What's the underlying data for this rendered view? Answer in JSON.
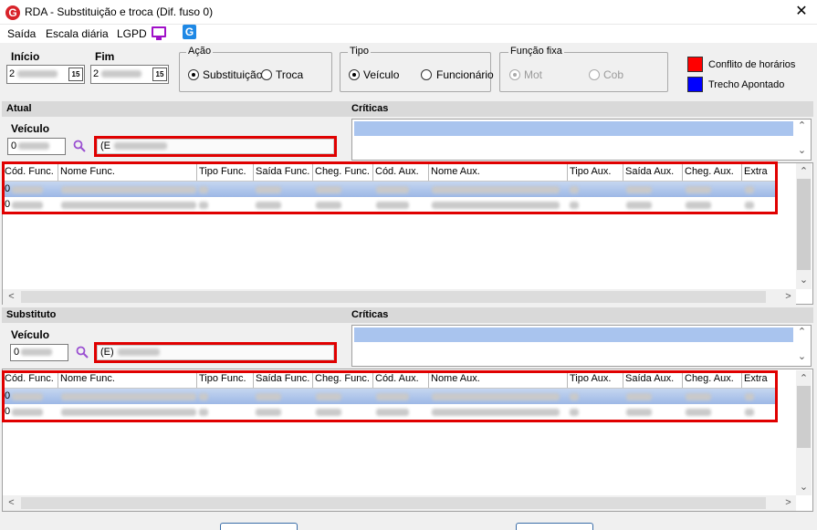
{
  "window": {
    "title": "RDA - Substituição e troca (Dif. fuso 0)",
    "logo_letter": "G",
    "close_symbol": "✕"
  },
  "menu": {
    "items": [
      "Saída",
      "Escala diária",
      "LGPD"
    ],
    "icons": [
      "monitor-icon",
      "g-app-icon"
    ],
    "app_icon_letter": "G"
  },
  "filters": {
    "inicio_label": "Início",
    "inicio_value": "2",
    "fim_label": "Fim",
    "fim_value": "2",
    "calendar_btn": "15"
  },
  "acao": {
    "title": "Ação",
    "options": [
      {
        "label": "Substituição",
        "checked": true
      },
      {
        "label": "Troca",
        "checked": false
      }
    ]
  },
  "tipo": {
    "title": "Tipo",
    "options": [
      {
        "label": "Veículo",
        "checked": true
      },
      {
        "label": "Funcionário",
        "checked": false
      }
    ]
  },
  "funcao_fixa": {
    "title": "Função fixa",
    "options": [
      {
        "label": "Mot",
        "checked": true,
        "disabled": true
      },
      {
        "label": "Cob",
        "checked": false,
        "disabled": true
      }
    ]
  },
  "legend": {
    "items": [
      {
        "label": "Conflito de horários",
        "color": "#ff0000"
      },
      {
        "label": "Trecho Apontado",
        "color": "#0000ff"
      }
    ]
  },
  "columns": [
    "Cód. Func.",
    "Nome Func.",
    "Tipo Func.",
    "Saída Func.",
    "Cheg. Func.",
    "Cód. Aux.",
    "Nome Aux.",
    "Tipo Aux.",
    "Saída Aux.",
    "Cheg. Aux.",
    "Extra"
  ],
  "atual": {
    "section_title": "Atual",
    "criticas_title": "Críticas",
    "veiculo_label": "Veículo",
    "veiculo_code": "0",
    "veiculo_desc": "(E",
    "rows": [
      {
        "first_char": "0",
        "selected": true
      },
      {
        "first_char": "0",
        "selected": false
      }
    ]
  },
  "substituto": {
    "section_title": "Substituto",
    "criticas_title": "Críticas",
    "veiculo_label": "Veículo",
    "veiculo_code": "0",
    "veiculo_desc": "(E)",
    "rows": [
      {
        "first_char": "0",
        "selected": true
      },
      {
        "first_char": "0",
        "selected": false
      }
    ]
  },
  "scroll": {
    "up": "⌃",
    "down": "⌄",
    "left": "<",
    "right": ">"
  }
}
